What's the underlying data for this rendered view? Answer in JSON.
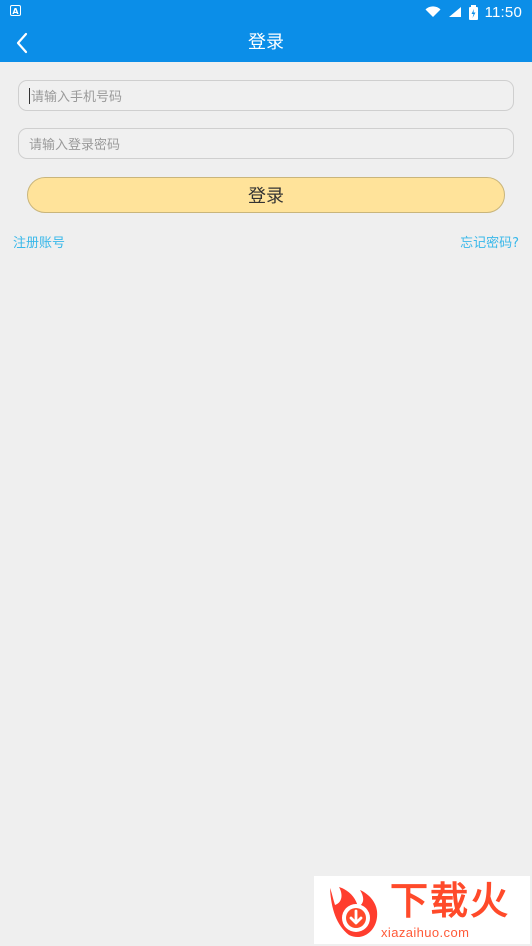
{
  "status_bar": {
    "left_icon": "A",
    "time": "11:50",
    "icons": [
      "wifi-icon",
      "signal-icon",
      "battery-icon"
    ]
  },
  "header": {
    "title": "登录",
    "back_icon": "chevron-left-icon"
  },
  "form": {
    "phone_placeholder": "请输入手机号码",
    "password_placeholder": "请输入登录密码",
    "login_button": "登录",
    "register_link": "注册账号",
    "forgot_link": "忘记密码?"
  },
  "watermark": {
    "brand": "下载火",
    "url": "xiazaihuo.com"
  },
  "colors": {
    "primary": "#0b8ee8",
    "button": "#ffe39a",
    "link": "#39b8ea",
    "background": "#efefef",
    "watermark": "#ff4a2a"
  }
}
